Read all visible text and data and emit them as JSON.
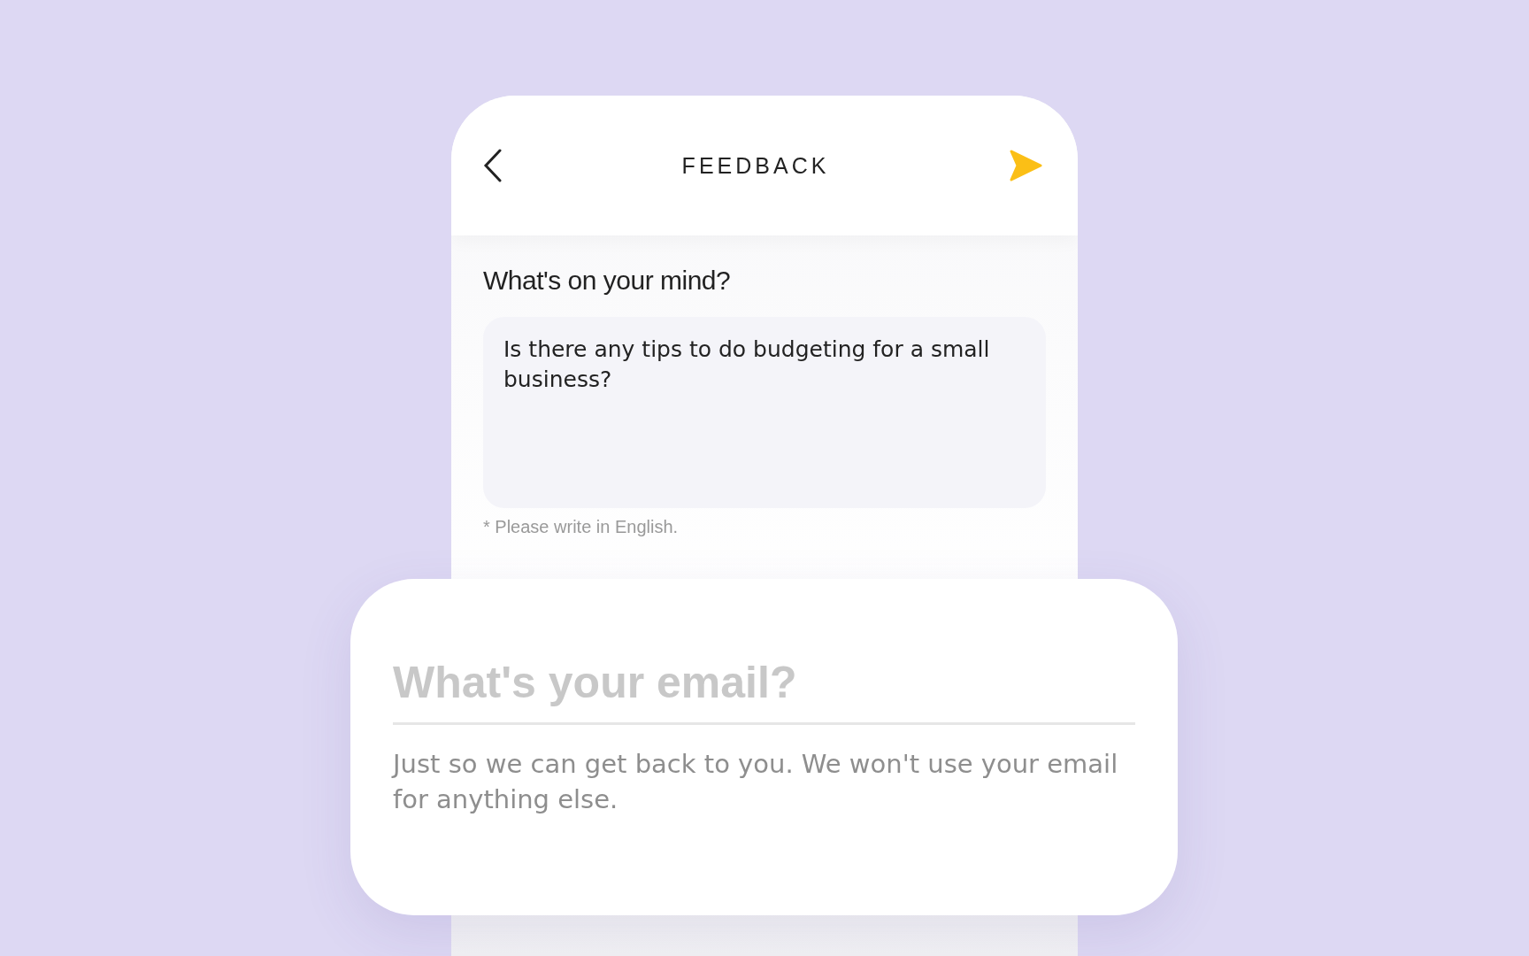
{
  "header": {
    "title": "FEEDBACK"
  },
  "question": {
    "label": "What's on your mind?",
    "value": "Is there any tips to do budgeting for a small business?",
    "note": "* Please write in English."
  },
  "email_card": {
    "placeholder": "What's your email?",
    "help": "Just so we can get back to you. We won't use your email for anything else."
  }
}
